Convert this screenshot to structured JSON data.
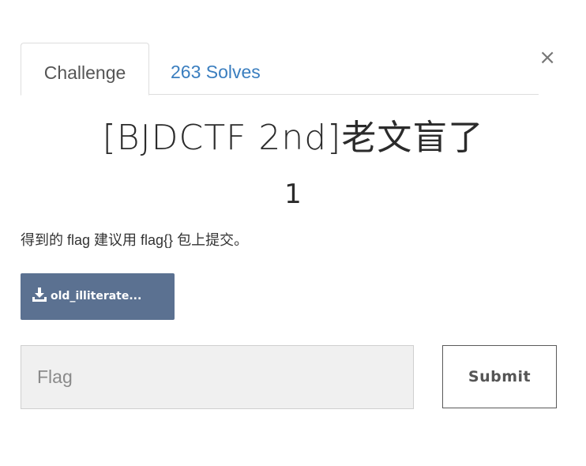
{
  "modal": {
    "close_label": "×"
  },
  "tabs": [
    {
      "label": "Challenge",
      "active": true
    },
    {
      "label": "263 Solves",
      "active": false
    }
  ],
  "challenge": {
    "name": "[BJDCTF 2nd]老文盲了",
    "points": "1",
    "description": "得到的 flag 建议用 flag{} 包上提交。",
    "file_label": "old_illiterate..."
  },
  "icons": {
    "download": "download-icon",
    "close": "close-icon"
  },
  "form": {
    "flag_placeholder": "Flag",
    "flag_value": "",
    "submit_label": "Submit"
  },
  "colors": {
    "accent_link": "#3a7ebf",
    "file_button": "#5b7191",
    "input_bg": "#f0f0f0"
  }
}
